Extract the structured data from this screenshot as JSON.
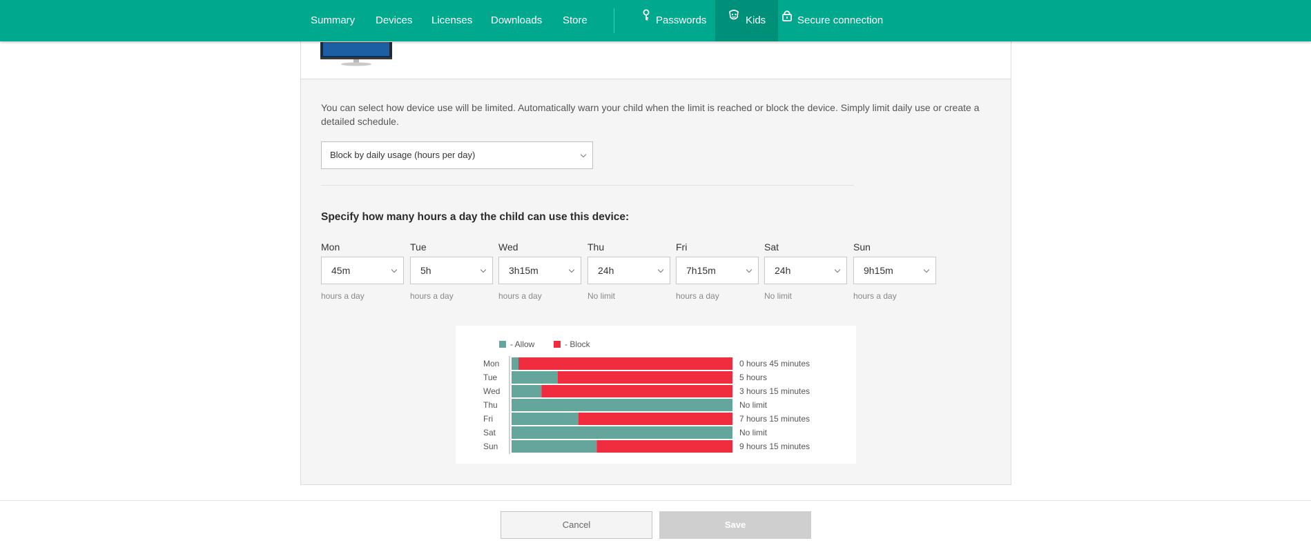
{
  "nav": {
    "items": [
      "Summary",
      "Devices",
      "Licenses",
      "Downloads",
      "Store"
    ],
    "right_items": [
      {
        "label": "Passwords",
        "icon": "key-icon"
      },
      {
        "label": "Kids",
        "icon": "kids-icon",
        "active": true
      },
      {
        "label": "Secure connection",
        "icon": "lock-icon"
      }
    ],
    "bg_color": "#00a88e",
    "active_color": "#008f79"
  },
  "description": "You can select how device use will be limited. Automatically warn your child when the limit is reached or block the device. Simply limit daily use or create a detailed schedule.",
  "mode_select": {
    "value": "Block by daily usage (hours per day)"
  },
  "heading": "Specify how many hours a day the child can use this device:",
  "days": [
    {
      "label": "Mon",
      "value": "45m",
      "note": "hours a day"
    },
    {
      "label": "Tue",
      "value": "5h",
      "note": "hours a day"
    },
    {
      "label": "Wed",
      "value": "3h15m",
      "note": "hours a day"
    },
    {
      "label": "Thu",
      "value": "24h",
      "note": "No limit"
    },
    {
      "label": "Fri",
      "value": "7h15m",
      "note": "hours a day"
    },
    {
      "label": "Sat",
      "value": "24h",
      "note": "No limit"
    },
    {
      "label": "Sun",
      "value": "9h15m",
      "note": "hours a day"
    }
  ],
  "chart_data": {
    "type": "bar",
    "orientation": "horizontal",
    "stacked": true,
    "categories": [
      "Mon",
      "Tue",
      "Wed",
      "Thu",
      "Fri",
      "Sat",
      "Sun"
    ],
    "series": [
      {
        "name": "- Allow",
        "color": "#64a69b",
        "values": [
          0.75,
          5,
          3.25,
          24,
          7.25,
          24,
          9.25
        ]
      },
      {
        "name": "- Block",
        "color": "#ef2d3f",
        "values": [
          23.25,
          19,
          20.75,
          0,
          16.75,
          0,
          14.75
        ]
      }
    ],
    "value_labels": [
      "0 hours 45 minutes",
      "5 hours",
      "3 hours 15 minutes",
      "No limit",
      "7 hours 15 minutes",
      "No limit",
      "9 hours 15 minutes"
    ],
    "xlim": [
      0,
      24
    ],
    "legend": "top"
  },
  "buttons": {
    "cancel": "Cancel",
    "save": "Save"
  }
}
